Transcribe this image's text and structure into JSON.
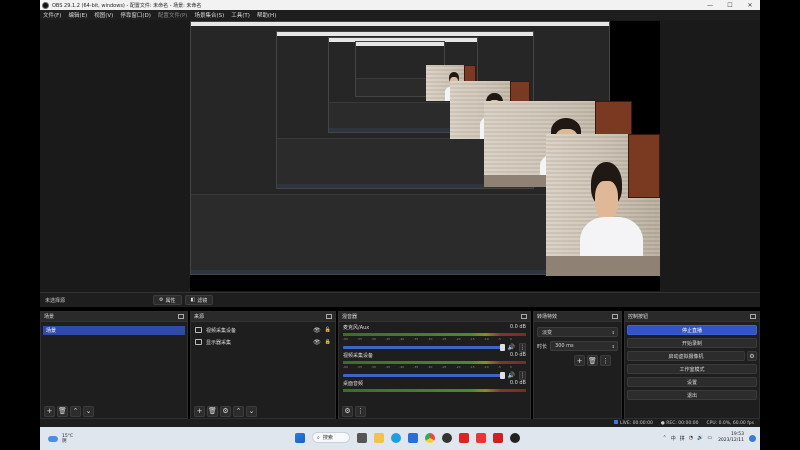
{
  "window": {
    "title": "OBS 29.1.2 (64-bit, windows) - 配置文件: 未命名 - 场景: 未命名",
    "controls": [
      "—",
      "☐",
      "✕"
    ]
  },
  "menu": [
    "文件(F)",
    "编辑(E)",
    "视图(V)",
    "停靠窗口(D)",
    "配置文件(P)",
    "场景集合(S)",
    "工具(T)",
    "帮助(H)"
  ],
  "scene_strip": {
    "no_source": "未选择源",
    "properties": "属性",
    "filters": "滤镜"
  },
  "scenes": {
    "title": "场景",
    "items": [
      "场景"
    ]
  },
  "sources": {
    "title": "来源",
    "items": [
      {
        "label": "视频采集设备",
        "icon": "camera-icon"
      },
      {
        "label": "显示器采集",
        "icon": "monitor-icon"
      }
    ]
  },
  "mixer": {
    "title": "混音器",
    "channels": [
      {
        "name": "麦克风/Aux",
        "db": "0.0 dB"
      },
      {
        "name": "视频采集设备",
        "db": "0.0 dB"
      },
      {
        "name": "桌面音频",
        "db": "0.0 dB"
      }
    ],
    "scale": [
      "-60",
      "-55",
      "-50",
      "-45",
      "-40",
      "-35",
      "-30",
      "-25",
      "-20",
      "-15",
      "-10",
      "-5",
      "0"
    ]
  },
  "transitions": {
    "title": "转场特效",
    "selected": "淡变",
    "duration_label": "时长",
    "duration": "300 ms"
  },
  "controls": {
    "title": "控制按钮",
    "buttons": {
      "stop_stream": "停止直播",
      "start_record": "开始录制",
      "virtual_cam": "启动虚拟摄像机",
      "studio_mode": "工作室模式",
      "settings": "设置",
      "exit": "退出"
    }
  },
  "status": {
    "live": "LIVE: 00:00:00",
    "rec": "REC: 00:00:00",
    "cpu": "CPU: 0.0%, 60.00 fps"
  },
  "taskbar": {
    "temp": "15°C",
    "weather": "阴",
    "search": "搜索",
    "ime1": "中",
    "ime2": "拼",
    "time": "19:53",
    "date": "2023/12/11"
  },
  "colors": {
    "accent": "#3155c4",
    "panel": "#1e1e1e"
  }
}
